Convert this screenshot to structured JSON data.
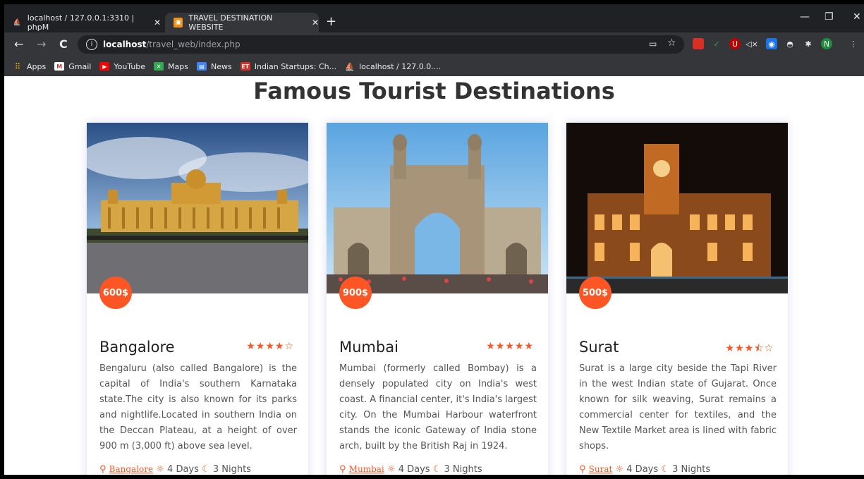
{
  "browser": {
    "tabs": [
      {
        "label": "localhost / 127.0.0.1:3310 | phpM"
      },
      {
        "label": "TRAVEL DESTINATION WEBSITE"
      }
    ],
    "address": {
      "host": "localhost",
      "path": "/travel_web/index.php"
    },
    "profile_initial": "N",
    "bookmarks": [
      {
        "label": "Apps",
        "icon": "apps-icon"
      },
      {
        "label": "Gmail",
        "icon": "gmail-icon"
      },
      {
        "label": "YouTube",
        "icon": "youtube-icon"
      },
      {
        "label": "Maps",
        "icon": "maps-icon"
      },
      {
        "label": "News",
        "icon": "news-icon"
      },
      {
        "label": "Indian Startups: Ch...",
        "icon": "et-icon"
      },
      {
        "label": "localhost / 127.0.0....",
        "icon": "phpmyadmin-icon"
      }
    ]
  },
  "page": {
    "heading": "Famous Tourist Destinations",
    "accent": "#fd5523",
    "cards": [
      {
        "price": "600$",
        "title": "Bangalore",
        "rating": 4,
        "stars": "★★★★☆",
        "description": "Bengaluru (also called Bangalore) is the capital of India's southern Karnataka state.The city is also known for its parks and nightlife.Located in southern India on the Deccan Plateau, at a height of over 900 m (3,000 ft) above sea level.",
        "location": "Bangalore",
        "days": "4 Days",
        "nights": "3 Nights"
      },
      {
        "price": "900$",
        "title": "Mumbai",
        "rating": 5,
        "stars": "★★★★★",
        "description": "Mumbai (formerly called Bombay) is a densely populated city on India's west coast. A financial center, it's India's largest city. On the Mumbai Harbour waterfront stands the iconic Gateway of India stone arch, built by the British Raj in 1924.",
        "location": "Mumbai",
        "days": "4 Days",
        "nights": "3 Nights"
      },
      {
        "price": "500$",
        "title": "Surat",
        "rating": 3.5,
        "stars": "★★★⯪☆",
        "description": "Surat is a large city beside the Tapi River in the west Indian state of Gujarat. Once known for silk weaving, Surat remains a commercial center for textiles, and the New Textile Market area is lined with fabric shops.",
        "location": "Surat",
        "days": "4 Days",
        "nights": "3 Nights"
      }
    ]
  }
}
